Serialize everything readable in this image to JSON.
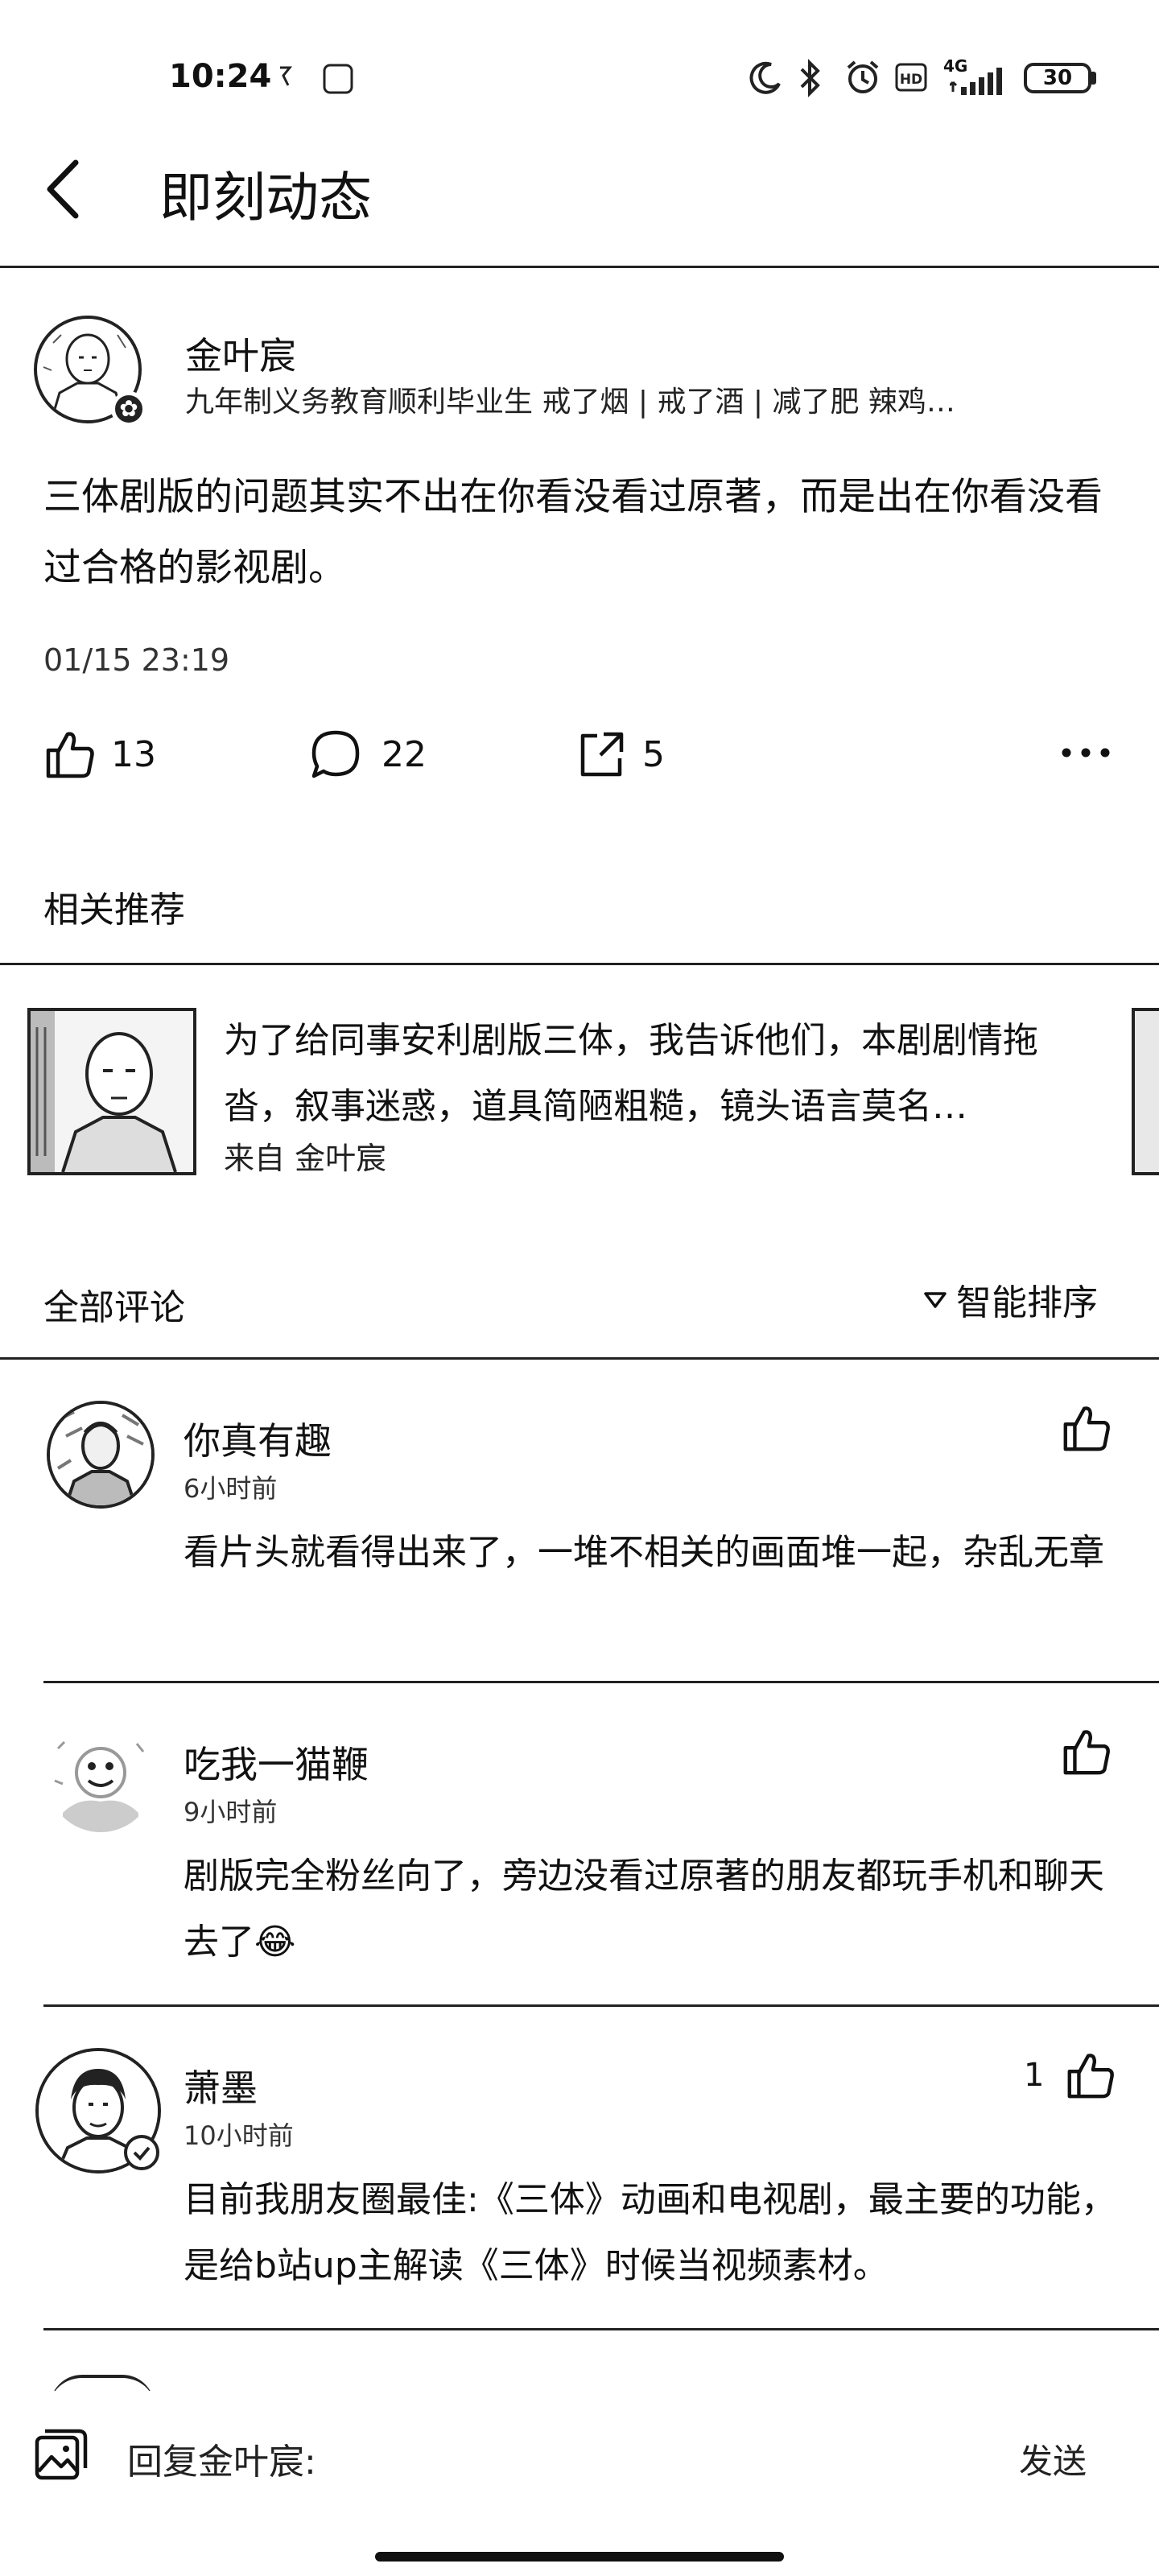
{
  "status_bar": {
    "time": "10:24",
    "network": "4G",
    "battery": "30"
  },
  "header": {
    "title": "即刻动态"
  },
  "post": {
    "author": "金叶宸",
    "bio": "九年制义务教育顺利毕业生  戒了烟 | 戒了酒 | 减了肥  辣鸡…",
    "content": "三体剧版的问题其实不出在你看没看过原著，而是出在你看没看过合格的影视剧。",
    "time": "01/15 23:19",
    "likes": "13",
    "comments": "22",
    "shares": "5"
  },
  "related": {
    "heading": "相关推荐",
    "card": {
      "text": "为了给同事安利剧版三体，我告诉他们，本剧剧情拖沓，叙事迷惑，道具简陋粗糙，镜头语言莫名…",
      "source": "来自 金叶宸"
    }
  },
  "comments_section": {
    "heading": "全部评论",
    "sort_label": "智能排序",
    "items": [
      {
        "name": "你真有趣",
        "time": "6小时前",
        "text": "看片头就看得出来了，一堆不相关的画面堆一起，杂乱无章",
        "likes": ""
      },
      {
        "name": "吃我一猫鞭",
        "time": "9小时前",
        "text": "剧版完全粉丝向了，旁边没看过原著的朋友都玩手机和聊天去了😂",
        "likes": ""
      },
      {
        "name": "萧墨",
        "time": "10小时前",
        "text": "目前我朋友圈最佳:《三体》动画和电视剧，最主要的功能，是给b站up主解读《三体》时候当视频素材。",
        "likes": "1"
      }
    ]
  },
  "reply_bar": {
    "placeholder": "回复金叶宸:",
    "send_label": "发送"
  }
}
